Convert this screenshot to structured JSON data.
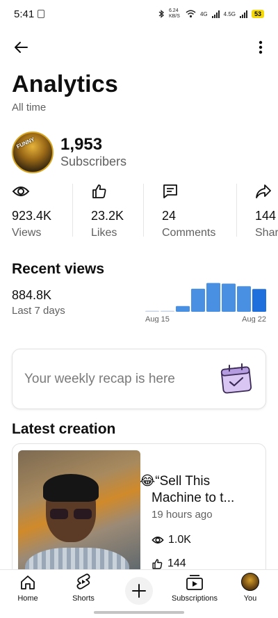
{
  "status_bar": {
    "time": "5:41",
    "net_speed": "6.24 KB/S",
    "network_1": "4G",
    "network_2": "4.5G",
    "battery": "53"
  },
  "header": {
    "back_icon": "arrow-left-icon",
    "more_icon": "more-vertical-icon"
  },
  "page": {
    "title": "Analytics",
    "subtitle": "All time"
  },
  "channel": {
    "avatar_badge": "FUNNY",
    "subscriber_count": "1,953",
    "subscriber_label": "Subscribers"
  },
  "metrics": [
    {
      "icon": "eye-icon",
      "value": "923.4K",
      "label": "Views"
    },
    {
      "icon": "thumbs-up-icon",
      "value": "23.2K",
      "label": "Likes"
    },
    {
      "icon": "comment-icon",
      "value": "24",
      "label": "Comments"
    },
    {
      "icon": "share-icon",
      "value": "144",
      "label": "Shares"
    }
  ],
  "recent_views": {
    "title": "Recent views",
    "value": "884.8K",
    "period": "Last 7 days"
  },
  "chart_data": {
    "type": "bar",
    "title": "",
    "tick_labels": [
      "Aug 15",
      "Aug 22"
    ],
    "values": [
      0.02,
      0.03,
      0.18,
      0.72,
      0.9,
      0.88,
      0.8,
      0.71
    ],
    "highlight_index": 7,
    "colors": {
      "bar": "#4a90e2",
      "highlight": "#1f6fdc",
      "baseline": "#c8d6e8"
    }
  },
  "recap": {
    "text": "Your weekly recap is here",
    "icon": "calendar-check-icon"
  },
  "latest_creation": {
    "title": "Latest creation",
    "emoji": "😂",
    "video_title_line1": "“Sell This",
    "video_title_line2": "Machine to t...",
    "time_ago": "19 hours ago",
    "views": "1.0K",
    "likes": "144"
  },
  "nav": {
    "home": "Home",
    "shorts": "Shorts",
    "subscriptions": "Subscriptions",
    "you": "You"
  }
}
